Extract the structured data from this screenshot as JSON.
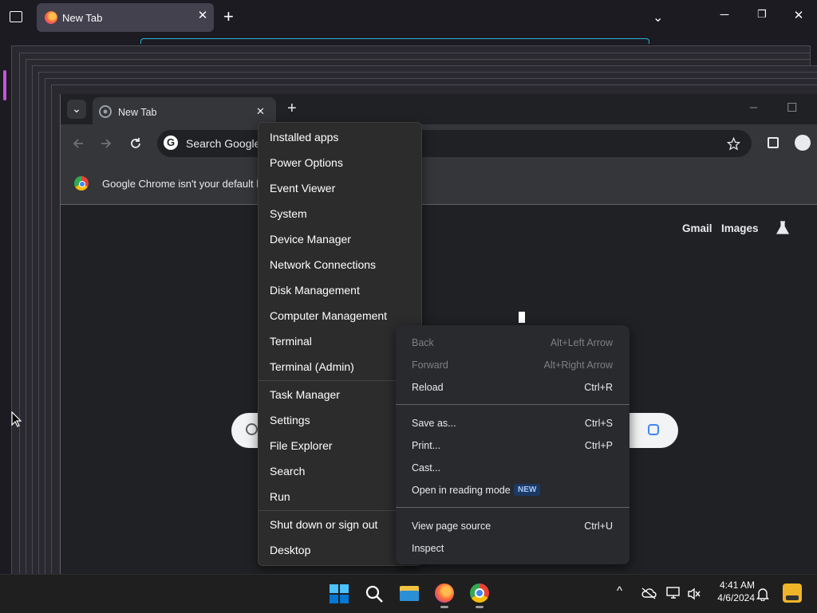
{
  "firefox": {
    "tab_title": "New Tab",
    "new_tab": "+",
    "close_tab": "✕",
    "list_all_tabs": "⌄",
    "minimize": "─",
    "maximize": "❐",
    "close_window": "✕"
  },
  "chrome": {
    "tab_title": "New Tab",
    "tab_close": "✕",
    "new_tab": "+",
    "tab_search": "⌄",
    "omnibox_placeholder": "Search Google",
    "infobar_text": "Google Chrome isn't your default b",
    "ntp_links": [
      "Gmail",
      "Images"
    ],
    "minimize": "─",
    "maximize": "☐"
  },
  "start_context_menu": {
    "group1": [
      "Installed apps",
      "Power Options",
      "Event Viewer",
      "System",
      "Device Manager",
      "Network Connections",
      "Disk Management",
      "Computer Management",
      "Terminal",
      "Terminal (Admin)"
    ],
    "group2": [
      "Task Manager",
      "Settings",
      "File Explorer",
      "Search",
      "Run"
    ],
    "group3": [
      "Shut down or sign out",
      "Desktop"
    ]
  },
  "chrome_context_menu": {
    "items": [
      {
        "label": "Back",
        "shortcut": "Alt+Left Arrow",
        "enabled": false
      },
      {
        "label": "Forward",
        "shortcut": "Alt+Right Arrow",
        "enabled": false
      },
      {
        "label": "Reload",
        "shortcut": "Ctrl+R",
        "enabled": true
      },
      {
        "label": "Save as...",
        "shortcut": "Ctrl+S",
        "enabled": true
      },
      {
        "label": "Print...",
        "shortcut": "Ctrl+P",
        "enabled": true
      },
      {
        "label": "Cast...",
        "shortcut": "",
        "enabled": true
      },
      {
        "label": "Open in reading mode",
        "shortcut": "",
        "enabled": true
      },
      {
        "label": "View page source",
        "shortcut": "Ctrl+U",
        "enabled": true
      },
      {
        "label": "Inspect",
        "shortcut": "",
        "enabled": true
      }
    ],
    "new_badge": "NEW"
  },
  "taskbar": {
    "time": "4:41 AM",
    "date": "4/6/2024",
    "tray_overflow": "^",
    "colors": {
      "windows": "#0078d4",
      "accent": "#4cc2ff"
    }
  }
}
